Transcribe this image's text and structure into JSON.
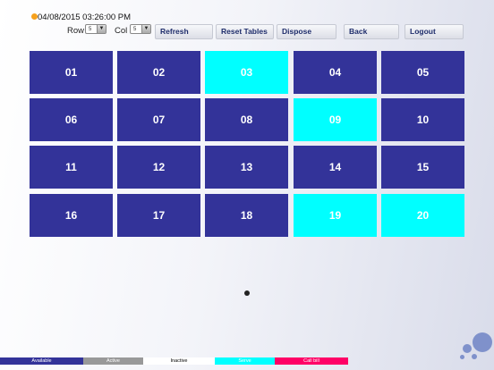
{
  "header": {
    "datetime": "04/08/2015 03:26:00 PM",
    "row_label": "Row",
    "row_value": "5",
    "col_label": "Col",
    "col_value": "5"
  },
  "toolbar": {
    "refresh": "Refresh",
    "reset_tables": "Reset Tables",
    "dispose": "Dispose",
    "back": "Back",
    "logout": "Logout"
  },
  "tables": [
    {
      "label": "01",
      "status": "available"
    },
    {
      "label": "02",
      "status": "available"
    },
    {
      "label": "03",
      "status": "serve"
    },
    {
      "label": "04",
      "status": "available"
    },
    {
      "label": "05",
      "status": "available"
    },
    {
      "label": "06",
      "status": "available"
    },
    {
      "label": "07",
      "status": "available"
    },
    {
      "label": "08",
      "status": "available"
    },
    {
      "label": "09",
      "status": "serve"
    },
    {
      "label": "10",
      "status": "available"
    },
    {
      "label": "11",
      "status": "available"
    },
    {
      "label": "12",
      "status": "available"
    },
    {
      "label": "13",
      "status": "available"
    },
    {
      "label": "14",
      "status": "available"
    },
    {
      "label": "15",
      "status": "available"
    },
    {
      "label": "16",
      "status": "available"
    },
    {
      "label": "17",
      "status": "available"
    },
    {
      "label": "18",
      "status": "available"
    },
    {
      "label": "19",
      "status": "serve"
    },
    {
      "label": "20",
      "status": "serve"
    }
  ],
  "legend": {
    "available": "Available",
    "active": "Active",
    "inactive": "Inactive",
    "serve": "Serve",
    "call_bill": "Call bill"
  },
  "colors": {
    "available": "#333399",
    "active": "#999999",
    "inactive": "#ffffff",
    "serve": "#00ffff",
    "call_bill": "#ff0066"
  }
}
